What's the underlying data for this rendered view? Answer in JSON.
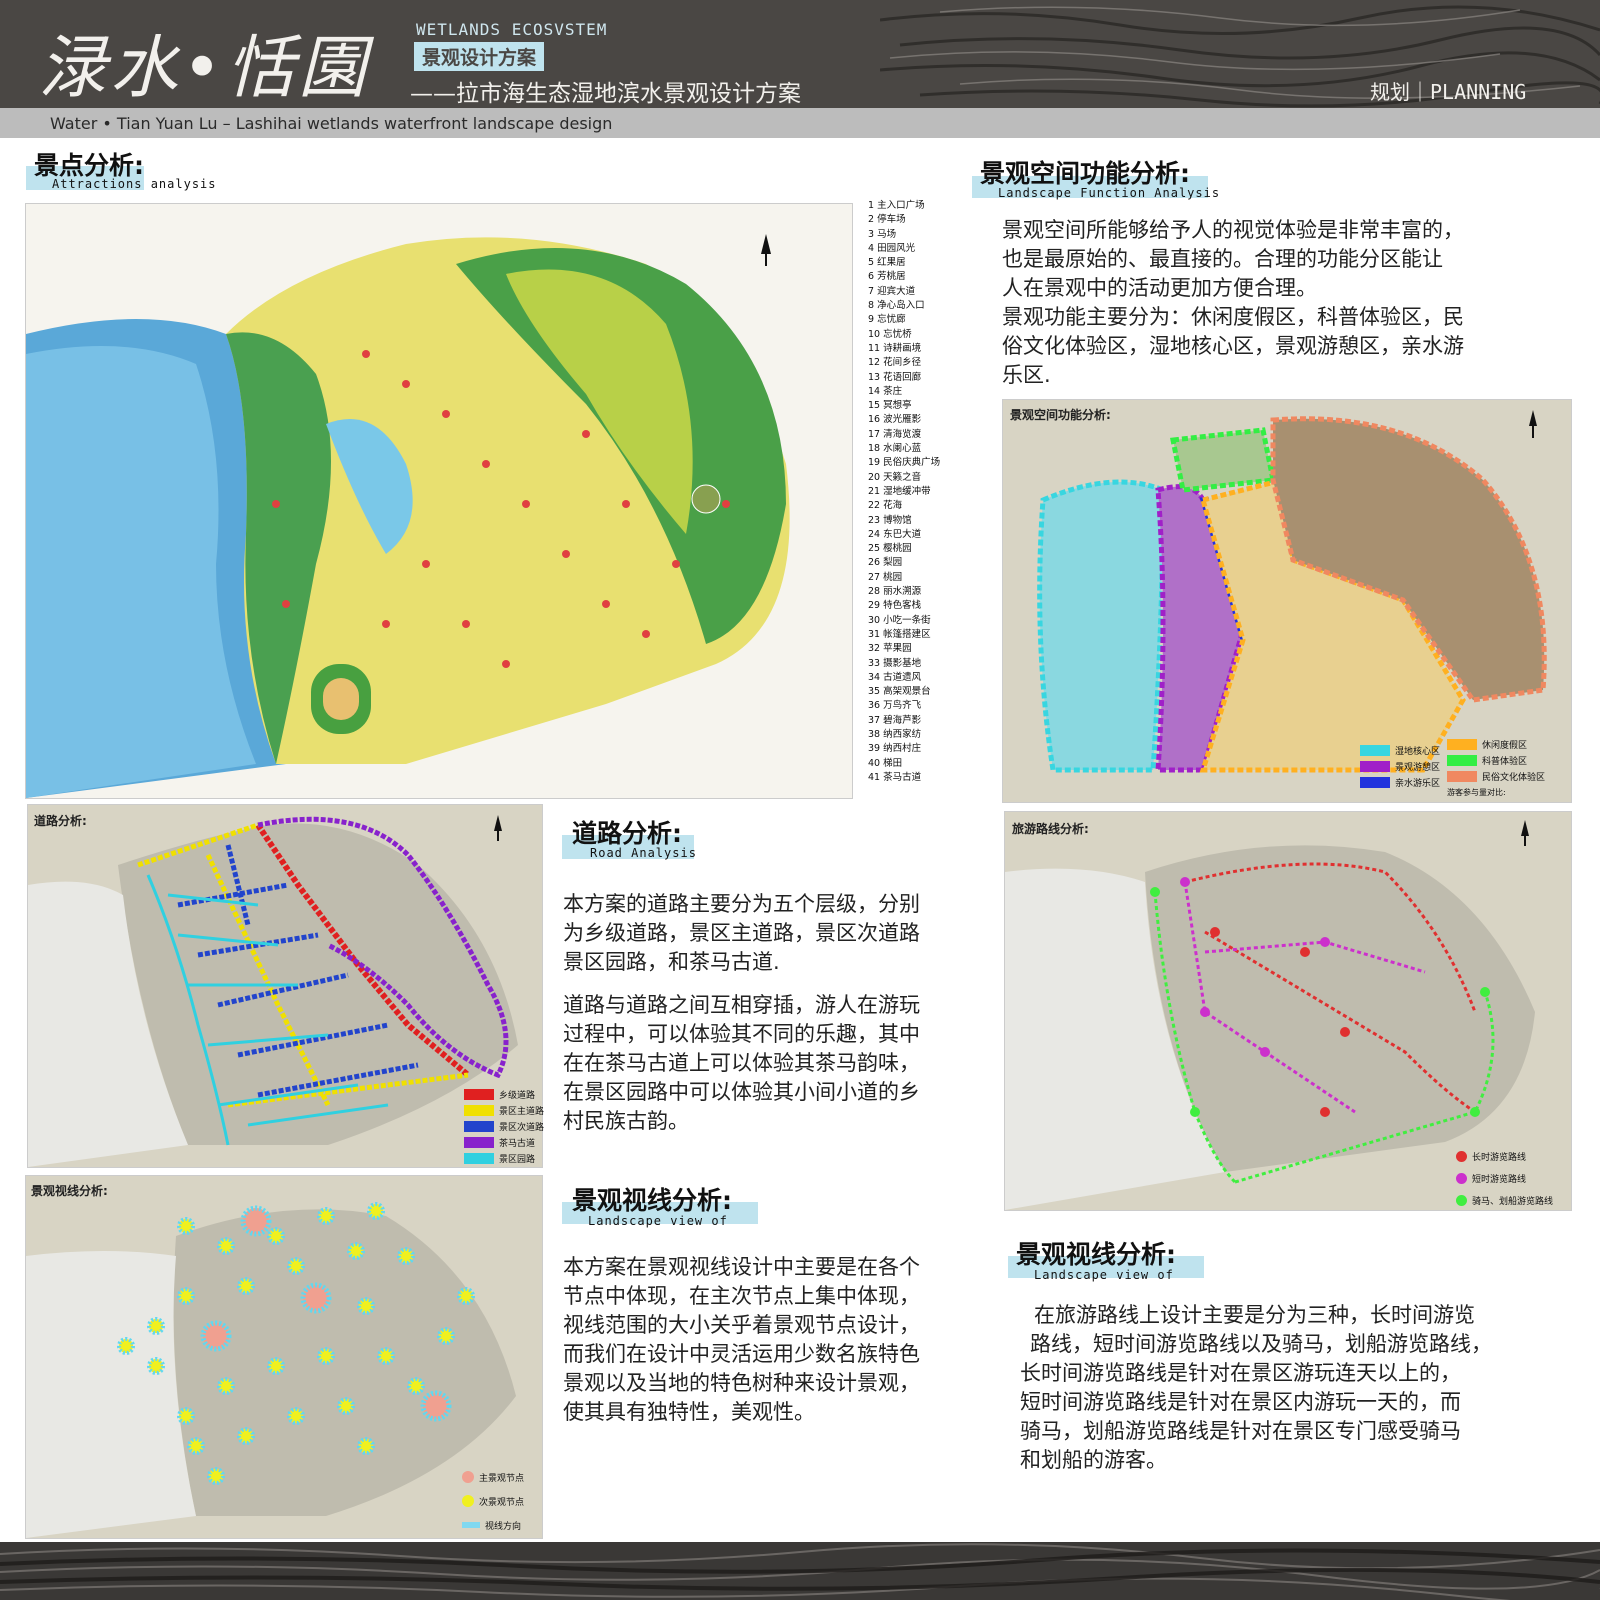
{
  "header": {
    "logo": "渌水•恬園",
    "eco_label": "WETLANDS ECOSVSTEM",
    "scheme_tag": "景观设计方案",
    "subtitle": "——拉市海生态湿地滨水景观设计方案",
    "planning": "规划｜PLANNING",
    "english_subtitle": "Water • Tian Yuan Lu – Lashihai wetlands waterfront landscape design"
  },
  "attractions": {
    "title": "景点分析:",
    "title_en": "Attractions analysis",
    "legend": [
      "1 主入口广场",
      "2 停车场",
      "3 马场",
      "4 田园风光",
      "5 红果居",
      "6 芳桃居",
      "7 迎宾大道",
      "8 净心岛入口",
      "9 忘忧廊",
      "10 忘忧桥",
      "11 诗耕画境",
      "12 花间乡径",
      "13 花语回廊",
      "14 茶庄",
      "15 冥想亭",
      "16 波光雁影",
      "17 清海览渡",
      "18 水阑心蓝",
      "19 民俗庆典广场",
      "20 天籁之音",
      "21 湿地缓冲带",
      "22 花海",
      "23 博物馆",
      "24 东巴大道",
      "25 樱桃园",
      "26 梨园",
      "27 桃园",
      "28 丽水溯源",
      "29 特色客栈",
      "30 小吃一条街",
      "31 帐篷搭建区",
      "32 苹果园",
      "33 摄影基地",
      "34 古道遗风",
      "35 高架观景台",
      "36 万鸟齐飞",
      "37 碧海芦影",
      "38 纳西家纺",
      "39 纳西村庄",
      "40 梯田",
      "41 茶马古道"
    ]
  },
  "function": {
    "title": "景观空间功能分析:",
    "title_en": "Landscape Function Analysis",
    "lines": [
      "景观空间所能够给予人的视觉体验是非常丰富的，",
      "也是最原始的、最直接的。合理的功能分区能让",
      "人在景观中的活动更加方便合理。",
      "景观功能主要分为：休闲度假区，科普体验区，民",
      "俗文化体验区，湿地核心区，景观游憩区，亲水游",
      "乐区."
    ],
    "map_label": "景观空间功能分析:",
    "legend": [
      {
        "name": "湿地核心区",
        "color": "#38d6e0"
      },
      {
        "name": "景观游憩区",
        "color": "#a020c8"
      },
      {
        "name": "亲水游乐区",
        "color": "#2233dd"
      },
      {
        "name": "休闲度假区",
        "color": "#ffb020"
      },
      {
        "name": "科普体验区",
        "color": "#33ee44"
      },
      {
        "name": "民俗文化体验区",
        "color": "#f08860"
      }
    ],
    "participation_label": "游客参与量对比:"
  },
  "road": {
    "title": "道路分析:",
    "title_en": "Road Analysis",
    "map_label": "道路分析:",
    "para1": [
      "本方案的道路主要分为五个层级，分别",
      "为乡级道路，景区主道路，景区次道路",
      "景区园路，和茶马古道."
    ],
    "para2": [
      "道路与道路之间互相穿插，游人在游玩",
      "过程中，可以体验其不同的乐趣，其中",
      "在在茶马古道上可以体验其茶马韵味，",
      "在景区园路中可以体验其小间小道的乡",
      "村民族古韵。"
    ],
    "legend": [
      {
        "name": "乡级道路",
        "color": "#e02020"
      },
      {
        "name": "景区主道路",
        "color": "#f0e000"
      },
      {
        "name": "景区次道路",
        "color": "#2244cc"
      },
      {
        "name": "茶马古道",
        "color": "#8822cc"
      },
      {
        "name": "景区园路",
        "color": "#30d0e0"
      }
    ]
  },
  "tour": {
    "map_label": "旅游路线分析:",
    "legend": [
      {
        "name": "长时游览路线",
        "color": "#e03030"
      },
      {
        "name": "短时游览路线",
        "color": "#cc30cc"
      },
      {
        "name": "骑马、划船游览路线",
        "color": "#40ee40"
      }
    ],
    "title": "景观视线分析:",
    "title_en": "Landscape view of",
    "lines": [
      "在旅游路线上设计主要是分为三种，长时间游览",
      "路线，短时间游览路线以及骑马，划船游览路线，",
      "长时间游览路线是针对在景区游玩连天以上的，",
      "短时间游览路线是针对在景区内游玩一天的，而",
      "骑马，划船游览路线是针对在景区专门感受骑马",
      "和划船的游客。"
    ]
  },
  "view": {
    "map_label": "景观视线分析:",
    "title": "景观视线分析:",
    "title_en": "Landscape view of",
    "lines": [
      "本方案在景观视线设计中主要是在各个",
      "节点中体现，在主次节点上集中体现，",
      "视线范围的大小关乎着景观节点设计，",
      "而我们在设计中灵活运用少数名族特色",
      "景观以及当地的特色树种来设计景观，",
      "使其具有独特性，美观性。"
    ],
    "legend": [
      {
        "name": "主景观节点",
        "color": "#f0a090"
      },
      {
        "name": "次景观节点",
        "color": "#f0f020"
      },
      {
        "name": "视线方向",
        "color": "#80d8f0"
      }
    ]
  }
}
